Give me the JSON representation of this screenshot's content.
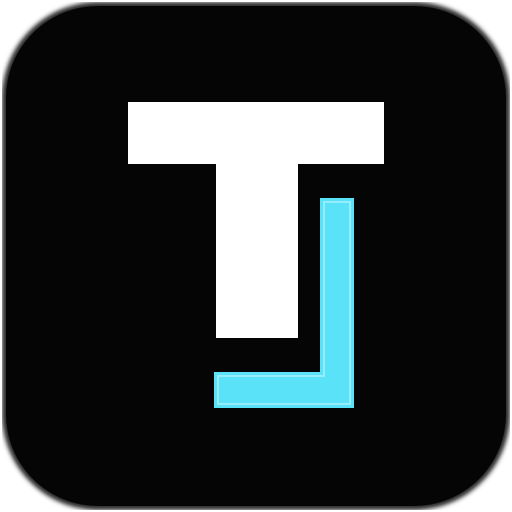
{
  "icon": {
    "name": "app-icon",
    "glyph_letter": "T",
    "colors": {
      "tile_background": "#050505",
      "tile_edge": "#2a2a2a",
      "t_fill": "#ffffff",
      "bracket_fill": "#5ae3f8",
      "bracket_highlight": "#c9f8ff"
    }
  }
}
